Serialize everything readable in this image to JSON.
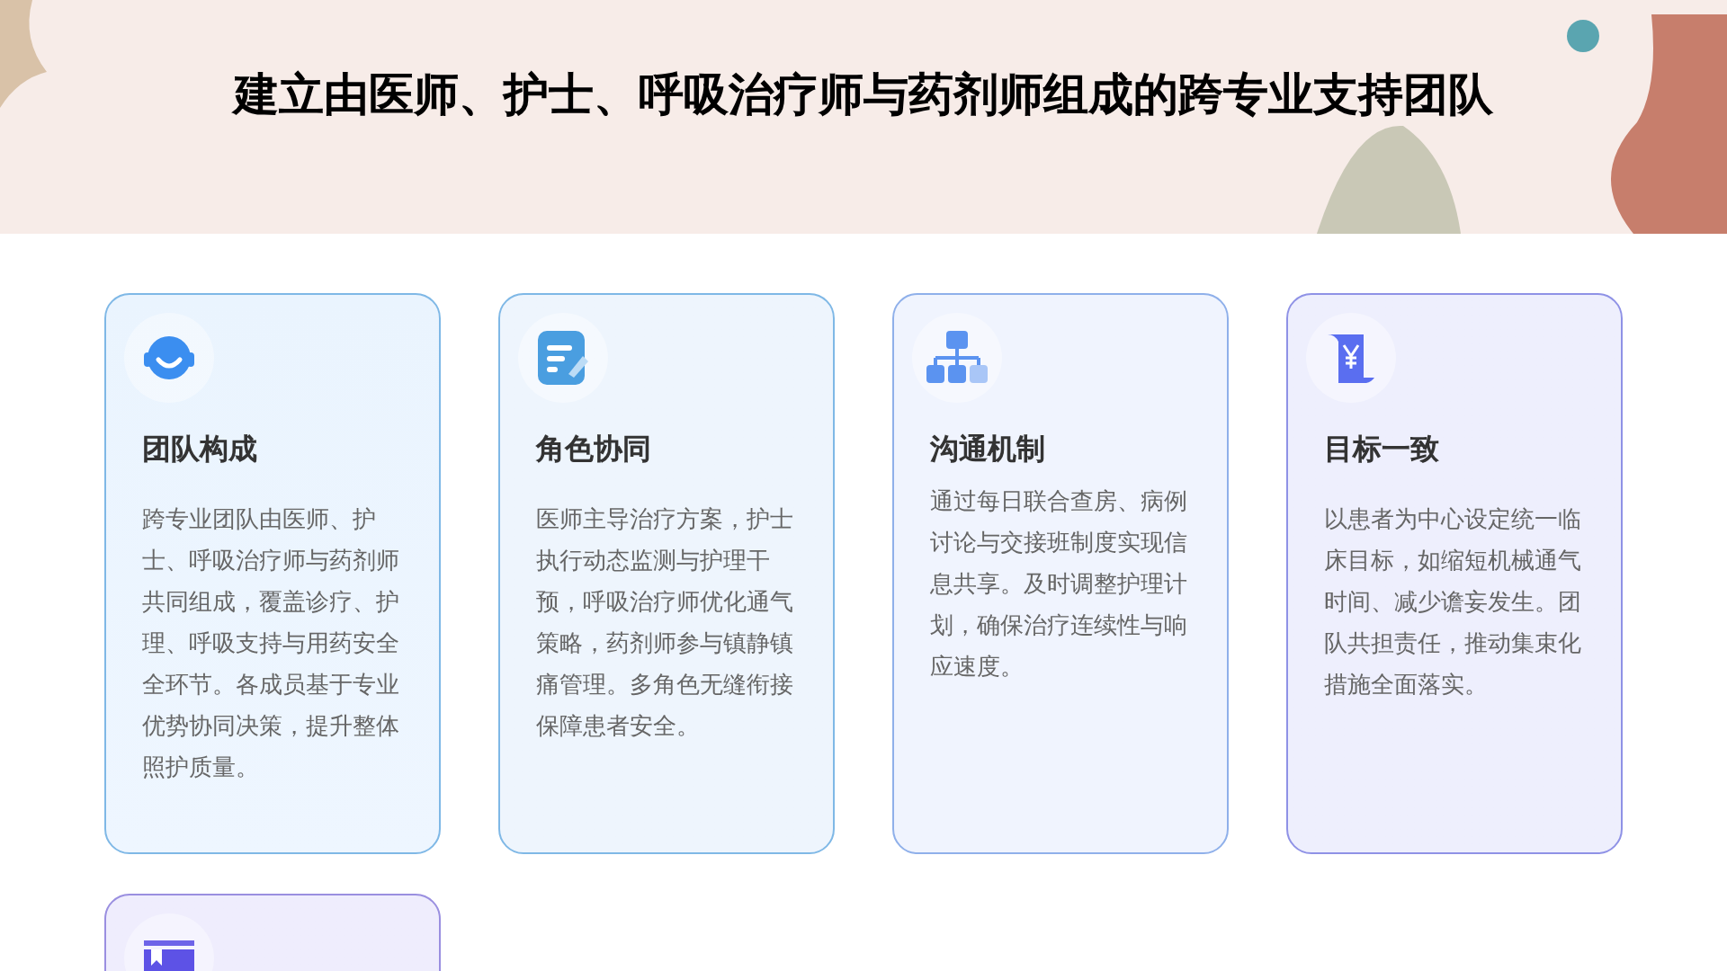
{
  "title": "建立由医师、护士、呼吸治疗师与药剂师组成的跨专业支持团队",
  "cards": [
    {
      "kind": "headset",
      "heading": "团队构成",
      "body": "跨专业团队由医师、护士、呼吸治疗师与药剂师共同组成，覆盖诊疗、护理、呼吸支持与用药安全全环节。各成员基于专业优势协同决策，提升整体照护质量。"
    },
    {
      "kind": "note",
      "heading": "角色协同",
      "body": "医师主导治疗方案，护士执行动态监测与护理干预，呼吸治疗师优化通气策略，药剂师参与镇静镇痛管理。多角色无缝衔接保障患者安全。"
    },
    {
      "kind": "org",
      "heading": "沟通机制",
      "body": "通过每日联合查房、病例讨论与交接班制度实现信息共享。及时调整护理计划，确保治疗连续性与响应速度。"
    },
    {
      "kind": "scroll",
      "heading": "目标一致",
      "body": "以患者为中心设定统一临床目标，如缩短机械通气时间、减少谵妄发生。团队共担责任，推动集束化措施全面落实。"
    },
    {
      "kind": "book"
    }
  ]
}
